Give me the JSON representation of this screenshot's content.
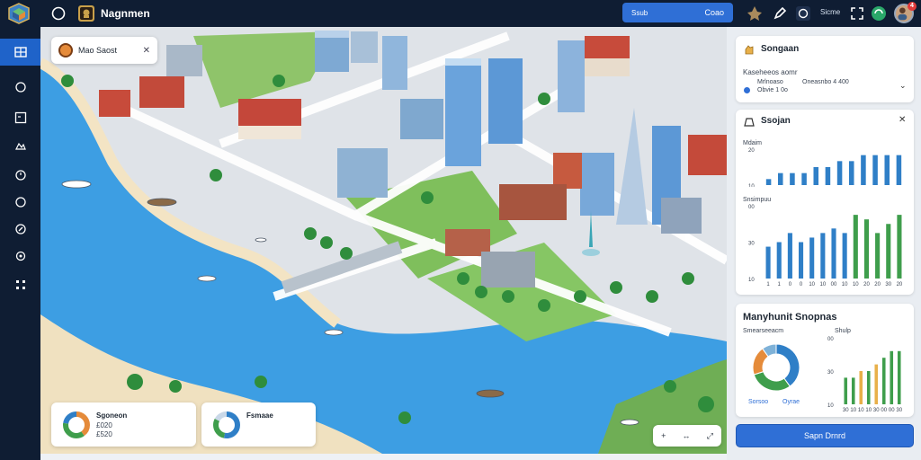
{
  "topbar": {
    "brand_name": "Nagnmen",
    "search_prefix": "Ssub",
    "search_term": "Coao",
    "status_text": "Sicme",
    "notification_count": "4"
  },
  "sidebar": {
    "items": [
      {
        "icon": "grid-icon",
        "active": true
      },
      {
        "icon": "circle-icon",
        "active": false
      },
      {
        "icon": "panel-icon",
        "active": false
      },
      {
        "icon": "layers-icon",
        "active": false
      },
      {
        "icon": "pin-icon",
        "active": false
      },
      {
        "icon": "clock-icon",
        "active": false
      },
      {
        "icon": "compass-icon",
        "active": false
      },
      {
        "icon": "network-icon",
        "active": false
      }
    ]
  },
  "map": {
    "search_label": "Mao Saost",
    "stat_cards": [
      {
        "title": "Sgoneon",
        "line1": "£020",
        "line2": "£520"
      },
      {
        "title": "Fsmaae",
        "line1": "",
        "line2": ""
      }
    ],
    "controls": [
      "+",
      "↔",
      "⤢"
    ]
  },
  "panel": {
    "info_card": {
      "title": "Songaan",
      "subtitle": "Kaseheeos aomr",
      "row_a": "Mrlnoaso",
      "row_b": "Oneasnbo 4 400",
      "row_c": "Obvie 1 0o",
      "accent": "#2f6fd6"
    },
    "bar_card": {
      "title": "Ssojan",
      "chart_data": [
        {
          "type": "bar",
          "series": [
            {
              "values": [
                1,
                2,
                2,
                2,
                3,
                3,
                4,
                4,
                5,
                5,
                5,
                5
              ],
              "color": "#2f7fc7"
            }
          ],
          "yticks": [
            "20",
            "10"
          ],
          "ytitle": "Mdaim",
          "ylim": [
            0,
            6
          ]
        },
        {
          "type": "bar",
          "series": [
            {
              "values": [
                7,
                8,
                10,
                8,
                9,
                10,
                11,
                10,
                14,
                13,
                10,
                12,
                14
              ],
              "colors": [
                "#2f7fc7",
                "#2f7fc7",
                "#2f7fc7",
                "#2f7fc7",
                "#2f7fc7",
                "#2f7fc7",
                "#2f7fc7",
                "#2f7fc7",
                "#3f9e4c",
                "#3f9e4c",
                "#3f9e4c",
                "#3f9e4c",
                "#3f9e4c"
              ]
            }
          ],
          "yticks": [
            "00",
            "30",
            "10"
          ],
          "ytitle": "Snsimpuu",
          "xlabels": [
            "1",
            "1",
            "0",
            "0",
            "10",
            "10",
            "00",
            "10",
            "10",
            "20",
            "20",
            "30",
            "20"
          ],
          "ylim": [
            0,
            16
          ]
        }
      ]
    },
    "mix_card": {
      "title": "Manyhunit Snopnas",
      "left_label": "Smearseeacm",
      "right_label": "Shulp",
      "chart_data": [
        {
          "type": "pie",
          "values": [
            40,
            30,
            20,
            10
          ],
          "colors": [
            "#2f7fc7",
            "#3f9e4c",
            "#e58b3a",
            "#7fb2d8"
          ],
          "legend": [
            "Sorsoo",
            "Oyrae"
          ]
        },
        {
          "type": "bar",
          "series": [
            {
              "values": [
                4,
                4,
                5,
                5,
                6,
                7,
                8,
                8
              ],
              "colors": [
                "#3f9e4c",
                "#3f9e4c",
                "#e8b04a",
                "#3f9e4c",
                "#e8b04a",
                "#3f9e4c",
                "#3f9e4c",
                "#3f9e4c"
              ]
            }
          ],
          "yticks": [
            "00",
            "30",
            "10"
          ],
          "xlabels": [
            "30",
            "10",
            "10",
            "10",
            "30",
            "00",
            "00",
            "30"
          ],
          "ylim": [
            0,
            10
          ]
        }
      ]
    },
    "primary_button": "Sapn Drnrd"
  }
}
